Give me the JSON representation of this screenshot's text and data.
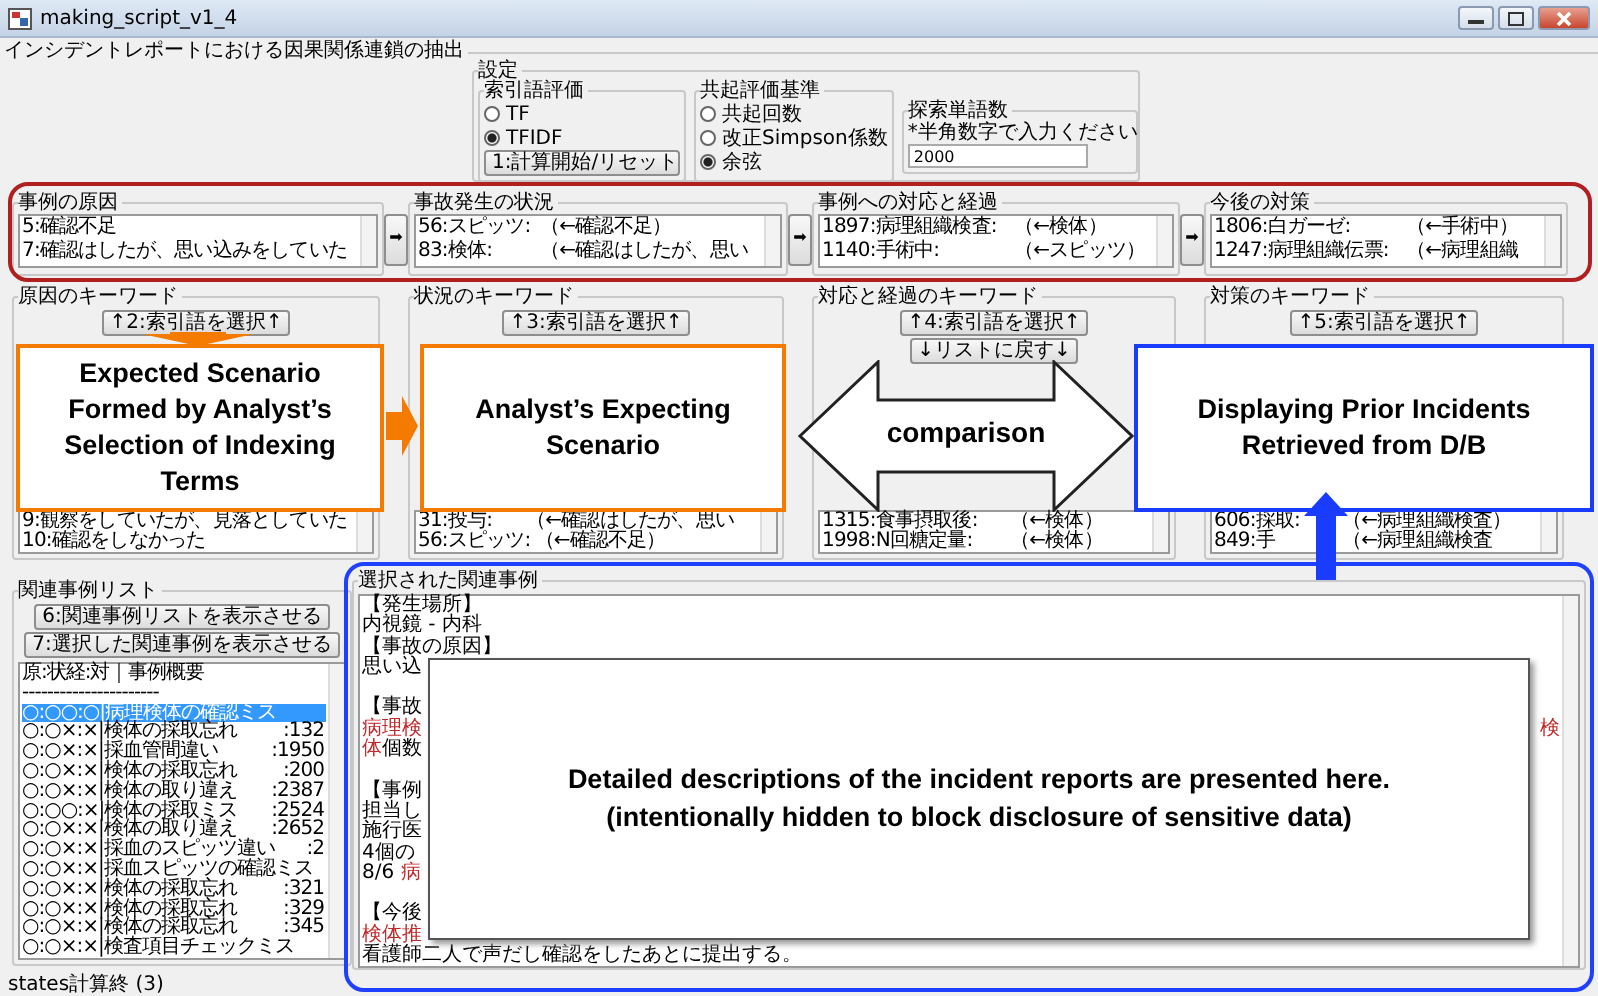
{
  "window": {
    "title": "making_script_v1_4"
  },
  "subtitle": "インシデントレポートにおける因果関係連鎖の抽出",
  "settings": {
    "title": "設定",
    "term_eval": {
      "title": "索引語評価",
      "options": [
        {
          "label": "TF",
          "selected": false
        },
        {
          "label": "TFIDF",
          "selected": true
        }
      ],
      "button": "1:計算開始/リセット"
    },
    "cooccurrence": {
      "title": "共起評価基準",
      "options": [
        {
          "label": "共起回数",
          "selected": false
        },
        {
          "label": "改正Simpson係数",
          "selected": false
        },
        {
          "label": "余弦",
          "selected": true
        }
      ]
    },
    "word_count": {
      "title": "探索単語数",
      "hint": "*半角数字で入力ください",
      "value": "2000"
    }
  },
  "chain": [
    {
      "title": "事例の原因",
      "items": [
        {
          "term": "5:確認不足"
        },
        {
          "term": "7:確認はしたが、思い込みをしていた"
        }
      ],
      "next_button": "➡"
    },
    {
      "title": "事故発生の状況",
      "items": [
        {
          "term": "56:スピッツ:",
          "reason": "（←確認不足）"
        },
        {
          "term": "83:検体:",
          "reason": "（←確認はしたが、思い"
        }
      ],
      "next_button": "➡"
    },
    {
      "title": "事例への対応と経過",
      "items": [
        {
          "term": "1897:病理組織検査:",
          "reason": "（←検体）"
        },
        {
          "term": "1140:手術中:",
          "reason": "（←スピッツ）"
        }
      ],
      "next_button": "➡"
    },
    {
      "title": "今後の対策",
      "items": [
        {
          "term": "1806:白ガーゼ:",
          "reason": "（←手術中）"
        },
        {
          "term": "1247:病理組織伝票:",
          "reason": "（←病理組織"
        }
      ]
    }
  ],
  "keywords": [
    {
      "title": "原因のキーワード",
      "select_button": "↑2:索引語を選択↑",
      "items": [
        {
          "term": "9:観察をしていたが、見落としていた"
        },
        {
          "term": "10:確認をしなかった"
        }
      ]
    },
    {
      "title": "状況のキーワード",
      "select_button": "↑3:索引語を選択↑",
      "items": [
        {
          "term": "31:投与:",
          "reason": "（←確認はしたが、思い"
        },
        {
          "term": "56:スピッツ:",
          "reason": "（←確認不足）"
        }
      ]
    },
    {
      "title": "対応と経過のキーワード",
      "select_button": "↑4:索引語を選択↑",
      "back_button": "↓リストに戻す↓",
      "items": [
        {
          "term": "1315:食事摂取後:",
          "reason": "（←検体）"
        },
        {
          "term": "1998:N回糖定量:",
          "reason": "（←検体）"
        }
      ]
    },
    {
      "title": "対策のキーワード",
      "select_button": "↑5:索引語を選択↑",
      "items": [
        {
          "term": "606:採取:",
          "reason": "（←病理組織検査）"
        },
        {
          "term": "849:手",
          "reason": "（←病理組織検査"
        }
      ]
    }
  ],
  "related": {
    "title": "関連事例リスト",
    "buttons": [
      "6:関連事例リストを表示させる",
      "7:選択した関連事例を表示させる"
    ],
    "header": "原:状経:対｜事例概要",
    "divider": "----------------------",
    "rows": [
      {
        "summary": "○:○○:○|病理検体の確認ミス",
        "selected": true
      },
      {
        "summary": "○:○×:×|検体の採取忘れ",
        "number": ":132",
        "selected": false
      },
      {
        "summary": "○:○×:×|採血管間違い",
        "number": ":1950",
        "selected": false
      },
      {
        "summary": "○:○×:×|検体の採取忘れ",
        "number": ":200",
        "selected": false
      },
      {
        "summary": "○:○×:×|検体の取り違え",
        "number": ":2387",
        "selected": false
      },
      {
        "summary": "○:○○:×|検体の採取ミス",
        "number": ":2524",
        "selected": false
      },
      {
        "summary": "○:○×:×|検体の取り違え",
        "number": ":2652",
        "selected": false
      },
      {
        "summary": "○:○×:×|採血のスピッツ違い",
        "number": ":2",
        "selected": false
      },
      {
        "summary": "○:○×:×|採血スピッツの確認ミス",
        "selected": false
      },
      {
        "summary": "○:○×:×|検体の採取忘れ",
        "number": ":321",
        "selected": false
      },
      {
        "summary": "○:○×:×|検体の採取忘れ",
        "number": ":329",
        "selected": false
      },
      {
        "summary": "○:○×:×|検体の採取忘れ",
        "number": ":345",
        "selected": false
      },
      {
        "summary": "○:○×:×|検査項目チェックミス",
        "selected": false
      }
    ]
  },
  "detail": {
    "title": "選択された関連事例",
    "lines": [
      {
        "segments": [
          {
            "text": "【発生場所】"
          }
        ]
      },
      {
        "segments": [
          {
            "text": "内視鏡 - 内科"
          }
        ]
      },
      {
        "segments": [
          {
            "text": "【事故の原因】"
          }
        ]
      },
      {
        "segments": [
          {
            "text": "思い込"
          }
        ]
      },
      {
        "gap_before": true,
        "segments": [
          {
            "text": "【事故"
          }
        ]
      },
      {
        "segments": [
          {
            "text": "病理検",
            "highlight": true
          }
        ],
        "tail": [
          {
            "text": "検",
            "highlight": true
          }
        ]
      },
      {
        "segments": [
          {
            "text": "体",
            "highlight": true
          },
          {
            "text": "個数"
          }
        ]
      },
      {
        "gap_before": true,
        "segments": [
          {
            "text": "【事例"
          }
        ]
      },
      {
        "segments": [
          {
            "text": "担当し"
          }
        ]
      },
      {
        "segments": [
          {
            "text": "施行医"
          }
        ]
      },
      {
        "segments": [
          {
            "text": "4個の"
          }
        ]
      },
      {
        "segments": [
          {
            "text": "8/6 "
          },
          {
            "text": "病",
            "highlight": true
          }
        ]
      },
      {
        "gap_before": true,
        "segments": [
          {
            "text": "【今後"
          }
        ]
      },
      {
        "segments": [
          {
            "text": "検体推",
            "highlight": true
          }
        ]
      },
      {
        "segments": [
          {
            "text": "看護師二人で声だし確認をしたあとに提出する。"
          }
        ]
      }
    ]
  },
  "status_bar": "states計算終 (3)",
  "annotations": {
    "boxes": [
      {
        "text": "Expected Scenario Formed by Analyst’s Selection of Indexing Terms",
        "color": "#f47a00"
      },
      {
        "text": "Analyst’s Expecting Scenario",
        "color": "#f47a00"
      },
      {
        "text": "Displaying Prior Incidents Retrieved from D/B",
        "color": "#1a3cff"
      }
    ],
    "comparison": "comparison",
    "note": [
      "Detailed descriptions of the incident reports are presented here.",
      "(intentionally hidden to block disclosure of sensitive data)"
    ]
  }
}
